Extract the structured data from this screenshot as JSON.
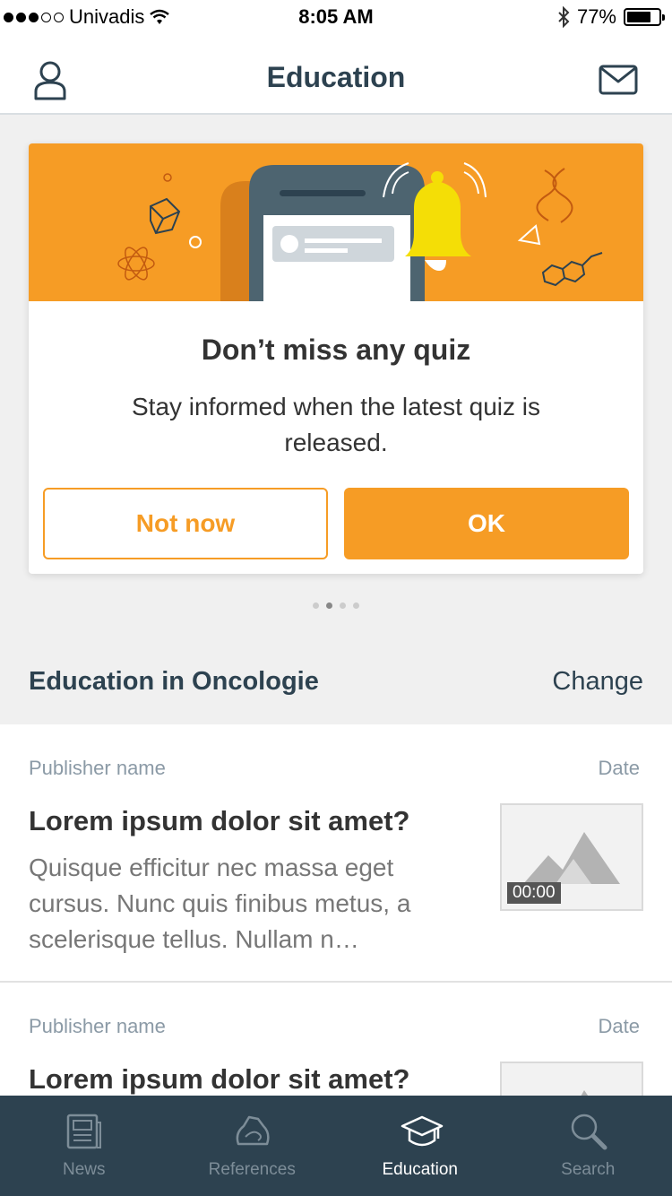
{
  "status_bar": {
    "carrier": "Univadis",
    "time": "8:05 AM",
    "battery": "77%",
    "battery_level": 0.77
  },
  "header": {
    "title": "Education",
    "left_icon": "user-icon",
    "right_icon": "mail-icon"
  },
  "promo": {
    "title": "Don’t miss any quiz",
    "text": "Stay informed when the latest quiz is released.",
    "secondary_label": "Not now",
    "primary_label": "OK",
    "accent_color": "#f69c25",
    "pager_count": 4,
    "pager_active": 1
  },
  "section": {
    "title": "Education in Oncologie",
    "action": "Change"
  },
  "list": {
    "items": [
      {
        "publisher": "Publisher name",
        "date": "Date",
        "title": "Lorem ipsum dolor sit amet?",
        "description": "Quisque efficitur nec massa eget cursus. Nunc quis finibus metus, a scelerisque tellus. Nullam n…",
        "duration": "00:00"
      },
      {
        "publisher": "Publisher name",
        "date": "Date",
        "title": "Lorem ipsum dolor sit amet?",
        "description": ""
      }
    ]
  },
  "tabs": [
    {
      "label": "News",
      "icon": "news-icon",
      "active": false
    },
    {
      "label": "References",
      "icon": "references-icon",
      "active": false
    },
    {
      "label": "Education",
      "icon": "education-icon",
      "active": true
    },
    {
      "label": "Search",
      "icon": "search-icon",
      "active": false
    }
  ],
  "colors": {
    "primary": "#2d4250",
    "accent": "#f69c25",
    "tab_inactive": "#7d8d98"
  }
}
